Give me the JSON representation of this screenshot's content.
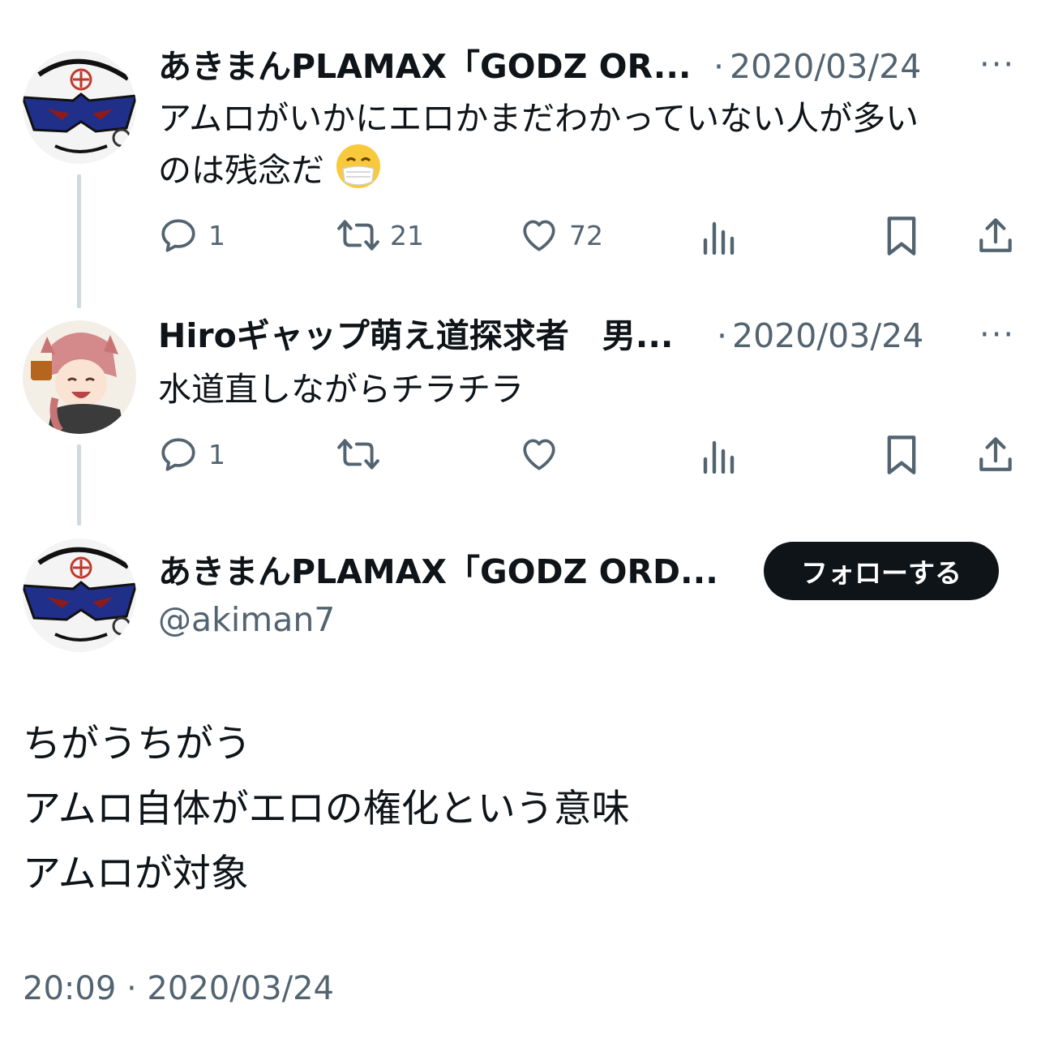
{
  "tweets": [
    {
      "author": "あきまんPLAMAX「GODZ OR...",
      "separator": "·",
      "date": "2020/03/24",
      "text_line1": "アムロがいかにエロかまだわかっていない人が多い",
      "text_line2": "のは残念だ",
      "emoji": "face-with-medical-mask",
      "more": "···",
      "actions": {
        "replies": "1",
        "retweets": "21",
        "likes": "72"
      }
    },
    {
      "author": "Hiroギャップ萌え道探求者　男...",
      "separator": "·",
      "date": "2020/03/24",
      "text": "水道直しながらチラチラ",
      "more": "···",
      "actions": {
        "replies": "1",
        "retweets": "",
        "likes": ""
      }
    }
  ],
  "focused": {
    "author": "あきまんPLAMAX「GODZ ORD...",
    "handle": "@akiman7",
    "follow_label": "フォローする",
    "lines": [
      "ちがうちがう",
      "アムロ自体がエロの権化という意味",
      "アムロが対象"
    ],
    "timestamp": "20:09 · 2020/03/24"
  },
  "icons": [
    "reply-icon",
    "retweet-icon",
    "like-icon",
    "views-icon",
    "bookmark-icon",
    "share-icon",
    "more-icon"
  ],
  "colors": {
    "text": "#0f1419",
    "secondary": "#536471",
    "thread_line": "#cfd9de",
    "button": "#0f1419"
  }
}
